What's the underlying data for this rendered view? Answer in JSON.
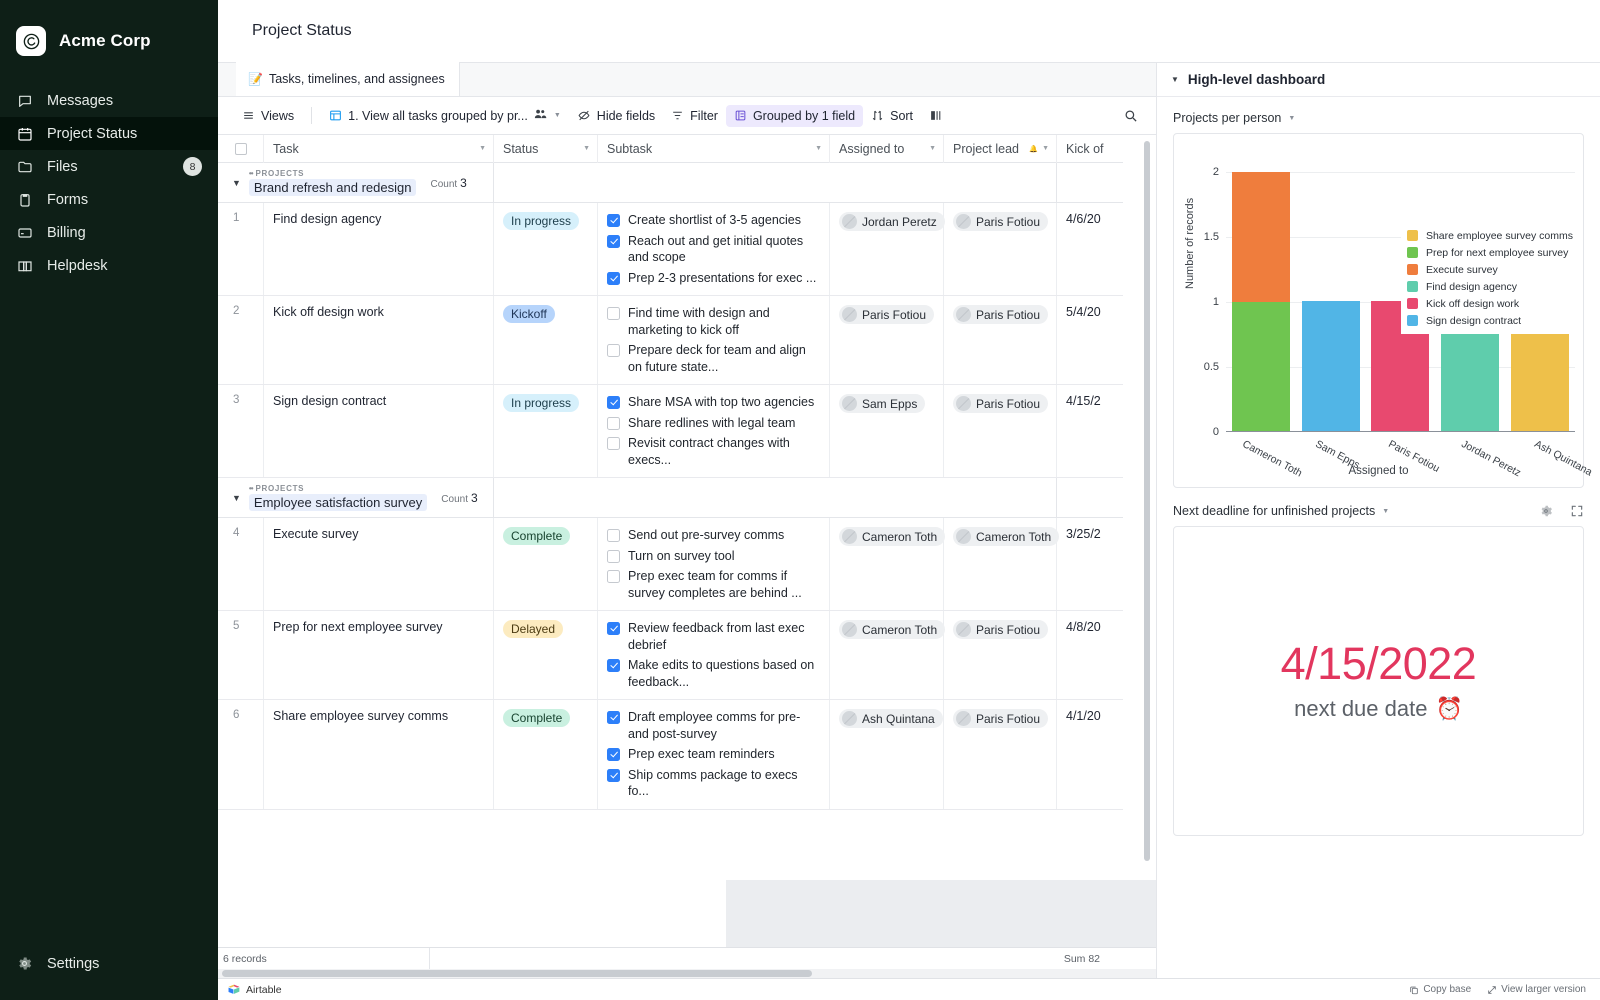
{
  "sidebar": {
    "brand": "Acme Corp",
    "brand_icon": "spiral-logo-icon",
    "items": [
      {
        "label": "Messages",
        "icon": "chat-bubble-icon",
        "badge": ""
      },
      {
        "label": "Project Status",
        "icon": "calendar-icon",
        "badge": ""
      },
      {
        "label": "Files",
        "icon": "folder-icon",
        "badge": "8"
      },
      {
        "label": "Forms",
        "icon": "clipboard-icon",
        "badge": ""
      },
      {
        "label": "Billing",
        "icon": "credit-card-icon",
        "badge": ""
      },
      {
        "label": "Helpdesk",
        "icon": "book-icon",
        "badge": ""
      }
    ],
    "settings": {
      "label": "Settings",
      "icon": "gear-icon"
    }
  },
  "header": {
    "title": "Project Status"
  },
  "tab": {
    "emoji": "📝",
    "label": "Tasks, timelines, and assignees"
  },
  "toolbar": {
    "views": "Views",
    "view_name": "1. View all tasks grouped by pr...",
    "hide_fields": "Hide fields",
    "filter": "Filter",
    "group": "Grouped by 1 field",
    "sort": "Sort",
    "row_height_icon": "row-height-icon",
    "collaborators_icon": "collaborators-icon",
    "search_icon": "search-icon"
  },
  "table": {
    "columns": [
      "Task",
      "Status",
      "Subtask",
      "Assigned to",
      "Project lead",
      "Kick of"
    ],
    "groups": [
      {
        "kicker": "PROJECTS",
        "name": "Brand refresh and redesign",
        "count_label": "Count",
        "count": "3",
        "rows": [
          {
            "num": "1",
            "task": "Find design agency",
            "status": "In progress",
            "status_class": "inprogress",
            "subtasks": [
              {
                "checked": true,
                "text": "Create shortlist of 3-5 agencies"
              },
              {
                "checked": true,
                "text": "Reach out and get initial quotes and scope"
              },
              {
                "checked": true,
                "text": "Prep 2-3 presentations for exec ..."
              }
            ],
            "assigned_to": "Jordan Peretz",
            "project_lead": "Paris Fotiou",
            "kickoff": "4/6/20"
          },
          {
            "num": "2",
            "task": "Kick off design work",
            "status": "Kickoff",
            "status_class": "kickoff",
            "subtasks": [
              {
                "checked": false,
                "text": "Find time with design and marketing to kick off"
              },
              {
                "checked": false,
                "text": "Prepare deck for team and align on future state..."
              }
            ],
            "assigned_to": "Paris Fotiou",
            "project_lead": "Paris Fotiou",
            "kickoff": "5/4/20"
          },
          {
            "num": "3",
            "task": "Sign design contract",
            "status": "In progress",
            "status_class": "inprogress",
            "subtasks": [
              {
                "checked": true,
                "text": "Share MSA with top two agencies"
              },
              {
                "checked": false,
                "text": "Share redlines with legal team"
              },
              {
                "checked": false,
                "text": "Revisit contract changes with execs..."
              }
            ],
            "assigned_to": "Sam Epps",
            "project_lead": "Paris Fotiou",
            "kickoff": "4/15/2"
          }
        ]
      },
      {
        "kicker": "PROJECTS",
        "name": "Employee satisfaction survey",
        "count_label": "Count",
        "count": "3",
        "rows": [
          {
            "num": "4",
            "task": "Execute survey",
            "status": "Complete",
            "status_class": "complete",
            "subtasks": [
              {
                "checked": false,
                "text": "Send out pre-survey comms"
              },
              {
                "checked": false,
                "text": "Turn on survey tool"
              },
              {
                "checked": false,
                "text": "Prep exec team for comms if survey completes are behind ..."
              }
            ],
            "assigned_to": "Cameron Toth",
            "project_lead": "Cameron Toth",
            "kickoff": "3/25/2"
          },
          {
            "num": "5",
            "task": "Prep for next employee survey",
            "status": "Delayed",
            "status_class": "delayed",
            "subtasks": [
              {
                "checked": true,
                "text": "Review feedback from last exec debrief"
              },
              {
                "checked": true,
                "text": "Make edits to questions based on feedback..."
              }
            ],
            "assigned_to": "Cameron Toth",
            "project_lead": "Paris Fotiou",
            "kickoff": "4/8/20"
          },
          {
            "num": "6",
            "task": "Share employee survey comms",
            "status": "Complete",
            "status_class": "complete",
            "subtasks": [
              {
                "checked": true,
                "text": "Draft employee comms for pre- and post-survey"
              },
              {
                "checked": true,
                "text": "Prep exec team reminders"
              },
              {
                "checked": true,
                "text": "Ship comms package to execs fo..."
              }
            ],
            "assigned_to": "Ash Quintana",
            "project_lead": "Paris Fotiou",
            "kickoff": "4/1/20"
          }
        ]
      }
    ],
    "status_bar": {
      "records": "6 records",
      "sum": "Sum 82"
    }
  },
  "right_panel": {
    "title": "High-level dashboard",
    "chart_section": {
      "title": "Projects per person"
    },
    "deadline_section": {
      "title": "Next deadline for unfinished projects",
      "settings_icon": "gear-icon",
      "expand_icon": "expand-icon",
      "date": "4/15/2022",
      "caption": "next due date",
      "caption_emoji": "⏰"
    }
  },
  "footer": {
    "brand": "Airtable",
    "copy_base": "Copy base",
    "view_larger": "View larger version"
  },
  "chart_data": {
    "type": "bar",
    "subtype": "stacked-bar",
    "title": "Projects per person",
    "xlabel": "Assigned to",
    "ylabel": "Number of records",
    "categories": [
      "Cameron Toth",
      "Sam Epps",
      "Paris Fotiou",
      "Jordan Peretz",
      "Ash Quintana"
    ],
    "ylim": [
      0,
      2
    ],
    "yticks": [
      "0",
      "0.5",
      "1",
      "1.5",
      "2"
    ],
    "grid": true,
    "legend_position": "inside-right",
    "series": [
      {
        "name": "Share employee survey comms",
        "color": "#eec04a",
        "values": [
          0,
          0,
          0,
          0,
          1
        ]
      },
      {
        "name": "Prep for next employee survey",
        "color": "#6fc550",
        "values": [
          1,
          0,
          0,
          0,
          0
        ]
      },
      {
        "name": "Execute survey",
        "color": "#ef7d3d",
        "values": [
          1,
          0,
          0,
          0,
          0
        ]
      },
      {
        "name": "Find design agency",
        "color": "#5fcdac",
        "values": [
          0,
          0,
          0,
          1,
          0
        ]
      },
      {
        "name": "Kick off design work",
        "color": "#e8496f",
        "values": [
          0,
          0,
          1,
          0,
          0
        ]
      },
      {
        "name": "Sign design contract",
        "color": "#51b5e6",
        "values": [
          0,
          1,
          0,
          0,
          0
        ]
      }
    ]
  }
}
